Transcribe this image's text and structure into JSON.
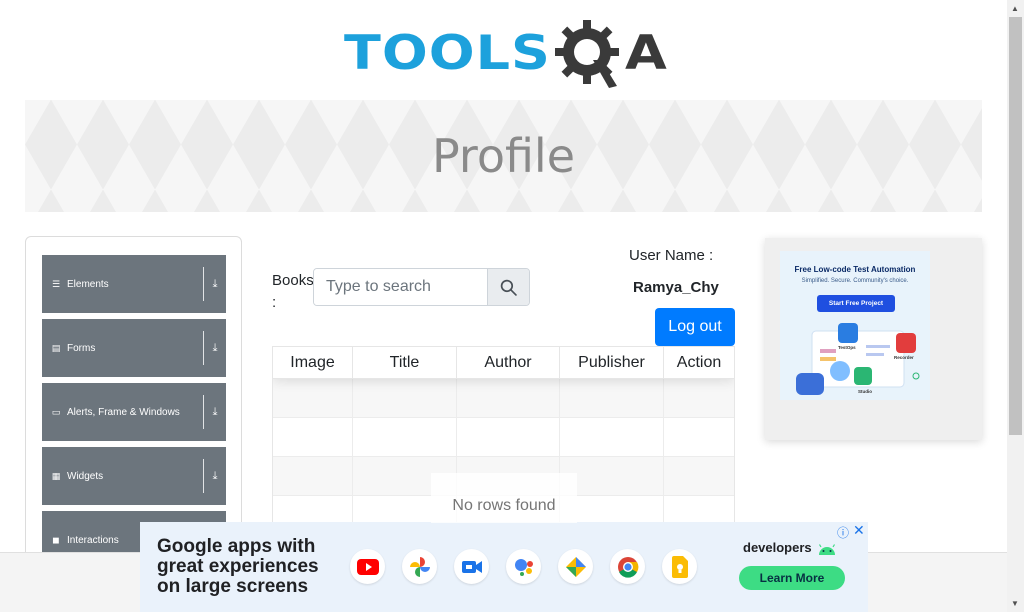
{
  "logo": {
    "text_left": "TOOLS",
    "text_right": "A",
    "colors": {
      "blue": "#1da1dc",
      "dark": "#3a3a3a"
    }
  },
  "banner": {
    "title": "Profile"
  },
  "sidebar": {
    "groups": [
      {
        "label": "Elements",
        "icon": "hamburger-icon"
      },
      {
        "label": "Forms",
        "icon": "document-icon"
      },
      {
        "label": "Alerts, Frame & Windows",
        "icon": "window-icon"
      },
      {
        "label": "Widgets",
        "icon": "grid-icon"
      },
      {
        "label": "Interactions",
        "icon": "square-icon"
      }
    ],
    "arrow_icon": "download-arrow-icon"
  },
  "books": {
    "label": "Books :",
    "search_placeholder": "Type to search",
    "search_icon": "search-icon"
  },
  "user": {
    "label": "User Name :",
    "value": "Ramya_Chy",
    "logout_label": "Log out"
  },
  "table": {
    "columns": [
      "Image",
      "Title",
      "Author",
      "Publisher",
      "Action"
    ],
    "empty_text": "No rows found"
  },
  "side_ad": {
    "title": "Free Low-code Test Automation",
    "subtitle": "Simplified. Secure. Community's choice.",
    "button": "Start Free Project",
    "labels": {
      "testops": "TestOps",
      "recorder": "Recorder",
      "studio": "Studio"
    }
  },
  "bottom_ad": {
    "headline": "Google apps with great experiences on large screens",
    "brand": "developers",
    "cta": "Learn More",
    "apps": [
      "youtube-icon",
      "google-photos-icon",
      "google-meet-icon",
      "google-assistant-icon",
      "google-maps-icon",
      "chrome-icon",
      "google-keep-icon"
    ],
    "colors": {
      "cta_bg": "#3ddc84",
      "background": "#eaf2fb"
    }
  },
  "colors": {
    "primary_button": "#007bff",
    "sidebar_group": "#6c757d"
  }
}
